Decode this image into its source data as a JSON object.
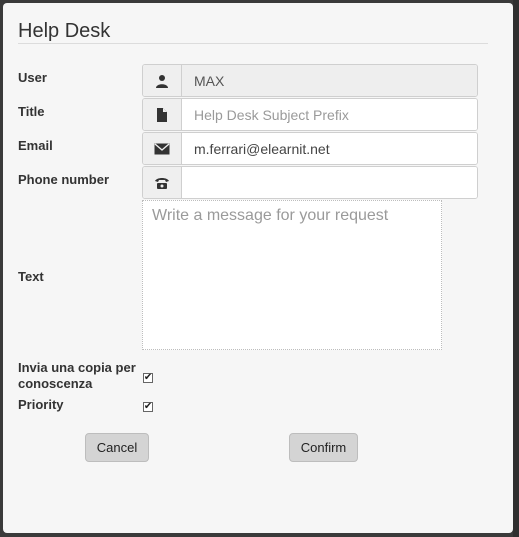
{
  "dialog": {
    "title": "Help Desk"
  },
  "form": {
    "user": {
      "label": "User",
      "value": "MAX",
      "icon": "user-icon"
    },
    "title": {
      "label": "Title",
      "placeholder": "Help Desk Subject Prefix",
      "value": "",
      "icon": "document-icon"
    },
    "email": {
      "label": "Email",
      "value": "m.ferrari@elearnit.net",
      "icon": "envelope-icon"
    },
    "phone": {
      "label": "Phone number",
      "value": "",
      "icon": "phone-icon"
    },
    "text": {
      "label": "Text",
      "placeholder": "Write a message for your request"
    },
    "copy": {
      "label": "Invia una copia per conoscenza",
      "checked": true
    },
    "priority": {
      "label": "Priority",
      "checked": true
    }
  },
  "buttons": {
    "cancel": "Cancel",
    "confirm": "Confirm"
  }
}
